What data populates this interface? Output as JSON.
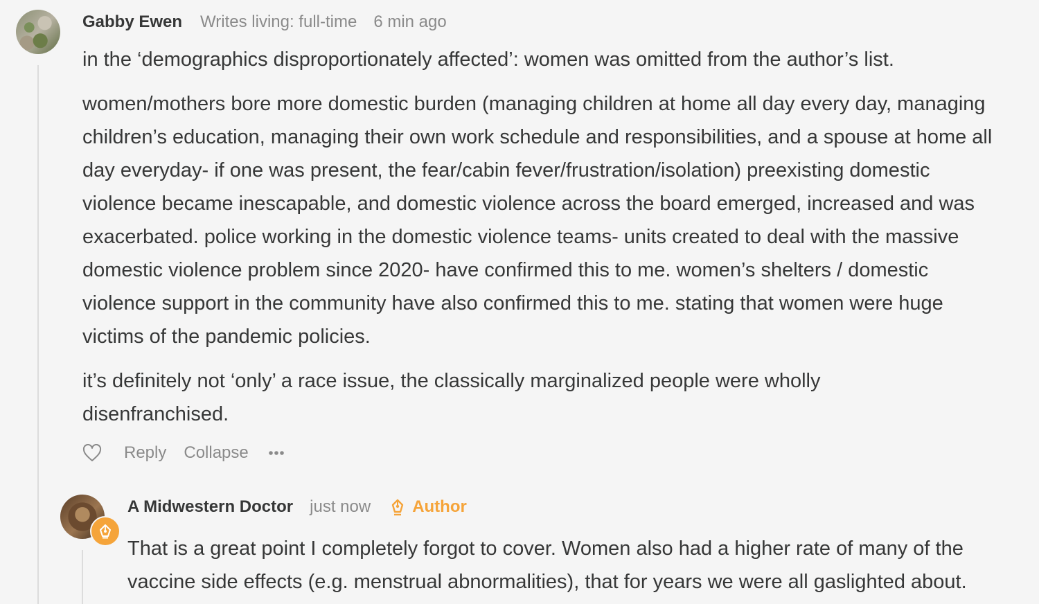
{
  "comment": {
    "author": "Gabby Ewen",
    "subtitle": "Writes living: full-time",
    "timestamp": "6 min ago",
    "paragraphs": [
      "in the ‘demographics disproportionately affected’: women was omitted from the author’s list.",
      "women/mothers bore more domestic burden (managing children at home all day every day, managing children’s education, managing their own work schedule and responsibilities, and a spouse at home all day everyday- if one was present, the fear/cabin fever/frustration/isolation) preexisting domestic violence became inescapable, and domestic violence across the board emerged, increased and was exacerbated. police working in the domestic violence teams- units created to deal with the massive domestic violence problem since 2020- have confirmed this to me. women’s shelters / domestic violence support in the community have also confirmed this to me. stating that women were huge victims of the pandemic policies.",
      "it’s definitely not ‘only’ a race issue, the classically marginalized people were wholly disenfranchised."
    ],
    "actions": {
      "reply": "Reply",
      "collapse": "Collapse"
    }
  },
  "reply": {
    "author": "A Midwestern Doctor",
    "timestamp": "just now",
    "badge": "Author",
    "text": "That is a great point I completely forgot to cover. Women also had a higher rate of many of the vaccine side effects (e.g. menstrual abnormalities), that for years we were all gaslighted about."
  },
  "icons": {
    "like": "heart-outline-icon",
    "more": "ellipsis-icon",
    "author": "pen-nib-icon"
  },
  "colors": {
    "accent": "#f5a43a",
    "text": "#363737",
    "muted": "#8a8a8a",
    "background": "#f5f5f5"
  }
}
